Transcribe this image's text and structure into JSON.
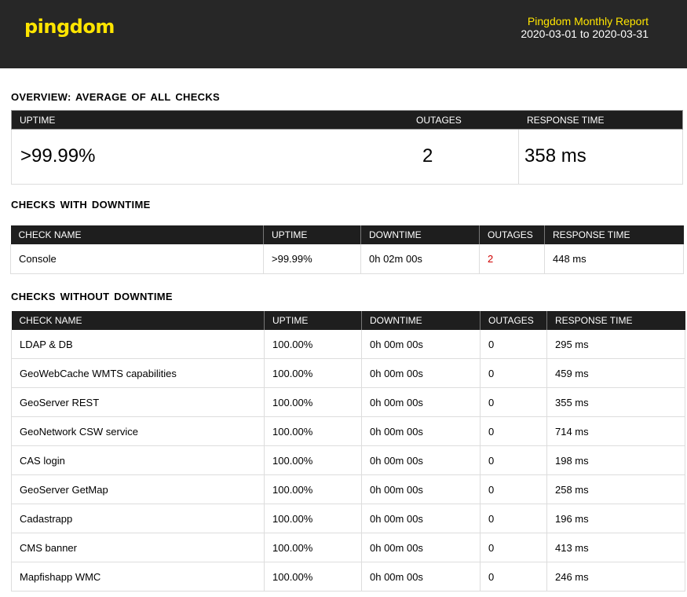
{
  "header": {
    "logo": "pingdom",
    "report_title": "Pingdom Monthly Report",
    "date_range": "2020-03-01 to 2020-03-31"
  },
  "overview": {
    "title": "OVERVIEW:  AVERAGE  OF ALL CHECKS",
    "headers": {
      "uptime": "UPTIME",
      "outages": "OUTAGES",
      "response": "RESPONSE TIME"
    },
    "uptime": ">99.99%",
    "outages": "2",
    "response": "358 ms"
  },
  "downtime": {
    "title": "CHECKS  WITH DOWNTIME",
    "headers": [
      "CHECK NAME",
      "UPTIME",
      "DOWNTIME",
      "OUTAGES",
      "RESPONSE TIME"
    ],
    "rows": [
      {
        "name": "Console",
        "uptime": ">99.99%",
        "downtime": "0h 02m 00s",
        "outages": "2",
        "response": "448 ms"
      }
    ],
    "outage_color": "#d00000"
  },
  "nodowntime": {
    "title": "CHECKS WITHOUT DOWNTIME",
    "headers": [
      "CHECK NAME",
      "UPTIME",
      "DOWNTIME",
      "OUTAGES",
      "RESPONSE TIME"
    ],
    "rows": [
      {
        "name": "LDAP & DB",
        "uptime": "100.00%",
        "downtime": "0h 00m 00s",
        "outages": "0",
        "response": "295 ms"
      },
      {
        "name": "GeoWebCache WMTS capabilities",
        "uptime": "100.00%",
        "downtime": "0h 00m 00s",
        "outages": "0",
        "response": "459 ms"
      },
      {
        "name": "GeoServer REST",
        "uptime": "100.00%",
        "downtime": "0h 00m 00s",
        "outages": "0",
        "response": "355 ms"
      },
      {
        "name": "GeoNetwork CSW service",
        "uptime": "100.00%",
        "downtime": "0h 00m 00s",
        "outages": "0",
        "response": "714 ms"
      },
      {
        "name": "CAS login",
        "uptime": "100.00%",
        "downtime": "0h 00m 00s",
        "outages": "0",
        "response": "198 ms"
      },
      {
        "name": "GeoServer GetMap",
        "uptime": "100.00%",
        "downtime": "0h 00m 00s",
        "outages": "0",
        "response": "258 ms"
      },
      {
        "name": "Cadastrapp",
        "uptime": "100.00%",
        "downtime": "0h 00m 00s",
        "outages": "0",
        "response": "196 ms"
      },
      {
        "name": "CMS banner",
        "uptime": "100.00%",
        "downtime": "0h 00m 00s",
        "outages": "0",
        "response": "413 ms"
      },
      {
        "name": "Mapfishapp WMC",
        "uptime": "100.00%",
        "downtime": "0h 00m 00s",
        "outages": "0",
        "response": "246 ms"
      }
    ]
  }
}
